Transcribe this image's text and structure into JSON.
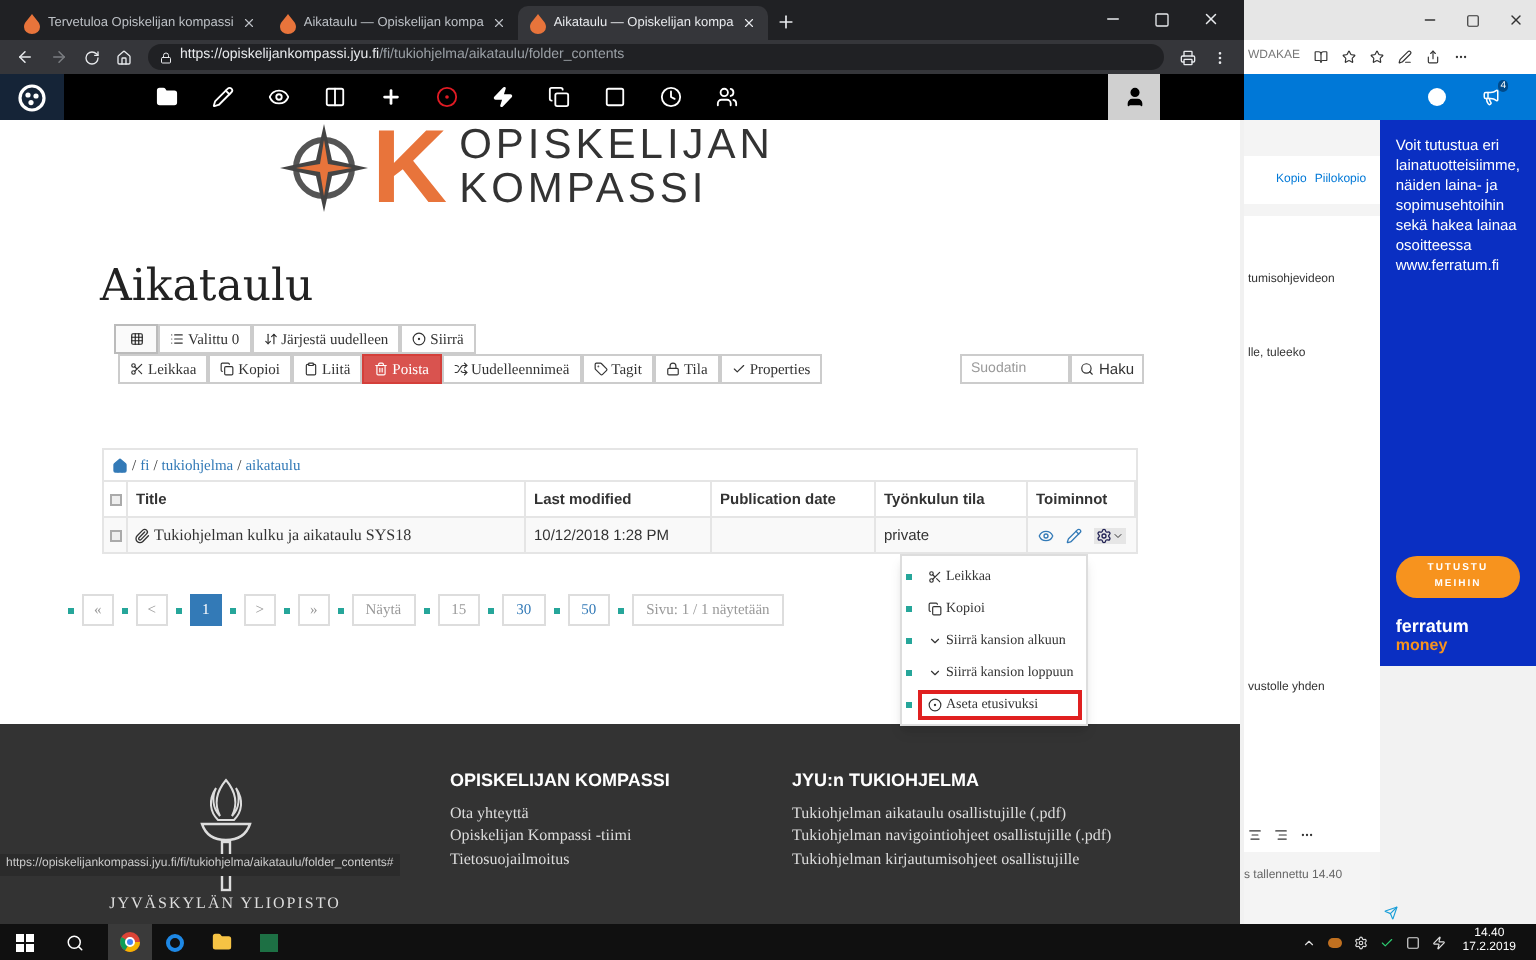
{
  "chrome": {
    "tabs": [
      {
        "label": "Tervetuloa Opiskelijan kompassi",
        "selected": false
      },
      {
        "label": "Aikataulu — Opiskelijan kompa",
        "selected": false
      },
      {
        "label": "Aikataulu — Opiskelijan kompa",
        "selected": true
      }
    ],
    "url": {
      "host": "https://opiskelijankompassi.jyu.fi",
      "path": "/fi/tukiohjelma/aikataulu/folder_contents"
    }
  },
  "site_header": {
    "logo_letter": "K",
    "logo_line_1": "OPISKELIJAN",
    "logo_line_2": "KOMPASSI"
  },
  "heading": "Aikataulu",
  "toolbar_row_1": [
    {
      "kind": "icon"
    },
    {
      "kind": "default",
      "label": "Valittu 0"
    },
    {
      "kind": "default",
      "label": "Järjestä uudelleen"
    },
    {
      "kind": "default",
      "label": "Siirrä"
    }
  ],
  "toolbar_row_2": [
    {
      "kind": "default",
      "label": "Leikkaa"
    },
    {
      "kind": "default",
      "label": "Kopioi"
    },
    {
      "kind": "default",
      "label": "Liitä"
    },
    {
      "kind": "danger",
      "label": "Poista"
    },
    {
      "kind": "default",
      "label": "Uudelleennimeä"
    },
    {
      "kind": "default",
      "label": "Tagit"
    },
    {
      "kind": "default",
      "label": "Tila"
    },
    {
      "kind": "default",
      "label": "Properties"
    }
  ],
  "filter": {
    "placeholder": "Suodatin",
    "button": "Haku"
  },
  "breadcrumb": [
    {
      "separator": "/",
      "label": "fi"
    },
    {
      "separator": "/",
      "label": "tukiohjelma"
    },
    {
      "separator": "/",
      "label": "aikataulu"
    }
  ],
  "table": {
    "all_checked": false,
    "columns": [
      "Title",
      "Last modified",
      "Publication date",
      "Työnkulun tila",
      "Toiminnot"
    ],
    "rows": [
      {
        "checked": false,
        "title": "Tukiohjelman kulku ja aikataulu SYS18",
        "last_modified": "10/12/2018 1:28 PM",
        "state": "private"
      }
    ]
  },
  "actions_menu": {
    "items": [
      {
        "label": "Leikkaa",
        "outlined": false
      },
      {
        "label": "Kopioi",
        "outlined": false
      },
      {
        "label": "Siirrä kansion alkuun",
        "outlined": false
      },
      {
        "label": "Siirrä kansion loppuun",
        "outlined": false
      },
      {
        "label": "Aseta etusivuksi",
        "outlined": true
      }
    ]
  },
  "pagination": {
    "pages": [
      {
        "label": "«",
        "selected": false
      },
      {
        "label": "<",
        "selected": false
      },
      {
        "label": "1",
        "selected": true
      },
      {
        "label": ">",
        "selected": false
      },
      {
        "label": "»",
        "selected": false
      }
    ],
    "show_label": "Näytä",
    "page_sizes": [
      "15",
      "30",
      "50"
    ],
    "summary": "Sivu: 1 / 1 näytetään"
  },
  "footer": {
    "university": "JYVÄSKYLÄN YLIOPISTO",
    "columns": [
      {
        "heading": "OPISKELIJAN KOMPASSI",
        "links": [
          "Ota yhteyttä",
          "Opiskelijan Kompassi -tiimi",
          "Tietosuojailmoitus"
        ]
      },
      {
        "heading": "JYU:n TUKIOHJELMA",
        "links": [
          "Tukiohjelman aikataulu osallistujille (.pdf)",
          "Tukiohjelman navigointiohjeet osallistujille (.pdf)",
          "Tukiohjelman kirjautumisohjeet osallistujille"
        ]
      }
    ]
  },
  "status_url": "https://opiskelijankompassi.jyu.fi/fi/tukiohjelma/aikataulu/folder_contents#",
  "edge": {
    "address_fragment": "WDAKAE",
    "notification_count": "4",
    "recipient_links": [
      "Kopio",
      "Piilokopio"
    ],
    "body_fragments": [
      "tumisohjevideon",
      "lle, tuleeko",
      "vustolle yhden"
    ],
    "saved_status": "s tallennettu 14.40",
    "ad": {
      "text": "Voit tutustua eri lainatuotteisiimme, näiden laina- ja sopimusehtoihin sekä hakea lainaa osoitteessa www.ferratum.fi",
      "button": "TUTUSTU MEIHIN",
      "brand": "ferratum",
      "brand_sub": "money"
    }
  },
  "taskbar": {
    "time": "14.40",
    "date": "17.2.2019"
  }
}
